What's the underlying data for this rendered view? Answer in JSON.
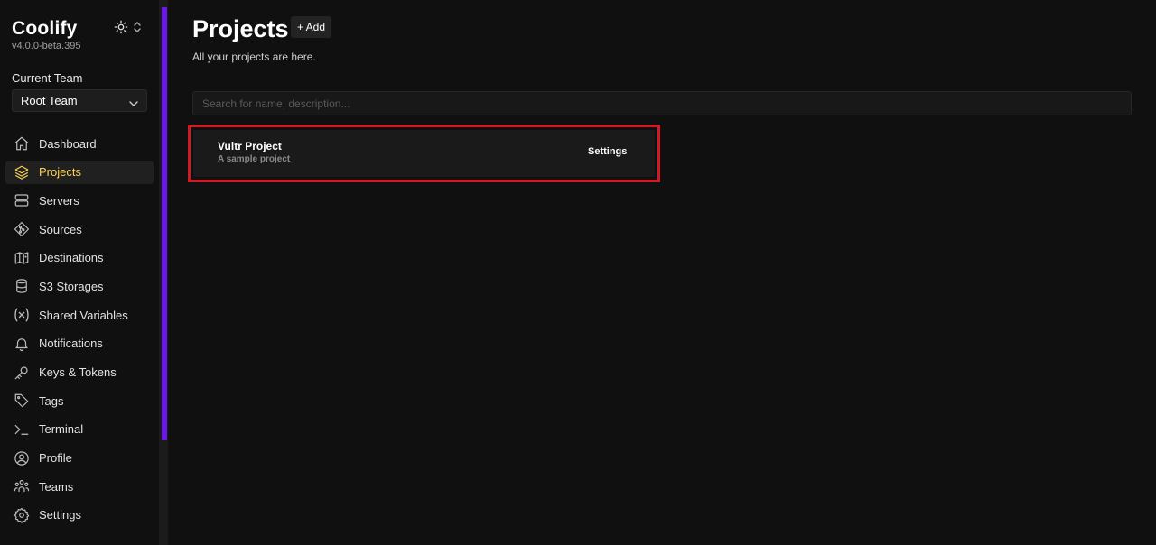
{
  "app": {
    "name": "Coolify",
    "version": "v4.0.0-beta.395"
  },
  "team": {
    "label": "Current Team",
    "selected": "Root Team"
  },
  "nav": {
    "items": [
      {
        "label": "Dashboard",
        "icon": "home-icon"
      },
      {
        "label": "Projects",
        "icon": "layers-icon",
        "active": true
      },
      {
        "label": "Servers",
        "icon": "server-icon"
      },
      {
        "label": "Sources",
        "icon": "git-icon"
      },
      {
        "label": "Destinations",
        "icon": "destination-icon"
      },
      {
        "label": "S3 Storages",
        "icon": "database-icon"
      },
      {
        "label": "Shared Variables",
        "icon": "variable-icon"
      },
      {
        "label": "Notifications",
        "icon": "bell-icon"
      },
      {
        "label": "Keys & Tokens",
        "icon": "key-icon"
      },
      {
        "label": "Tags",
        "icon": "tag-icon"
      },
      {
        "label": "Terminal",
        "icon": "terminal-icon"
      },
      {
        "label": "Profile",
        "icon": "user-circle-icon"
      },
      {
        "label": "Teams",
        "icon": "users-icon"
      },
      {
        "label": "Settings",
        "icon": "gear-icon"
      }
    ]
  },
  "page": {
    "title": "Projects",
    "add_label": "+ Add",
    "subtitle": "All your projects are here.",
    "search_placeholder": "Search for name, description..."
  },
  "projects": [
    {
      "name": "Vultr Project",
      "description": "A sample project",
      "settings_label": "Settings"
    }
  ],
  "colors": {
    "accent": "#6b16ed",
    "active_text": "#fcd452",
    "highlight": "#d11a21"
  }
}
